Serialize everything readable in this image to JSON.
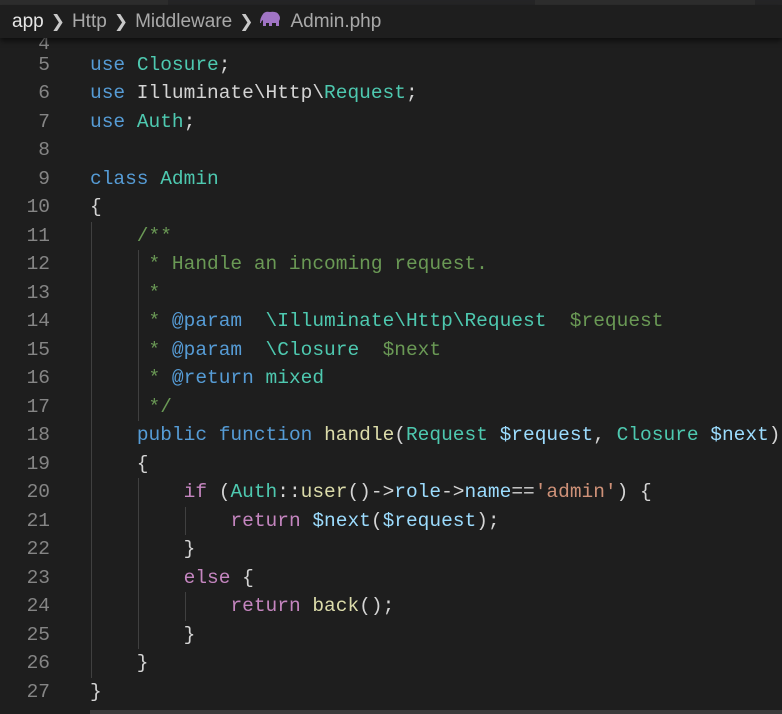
{
  "breadcrumb": {
    "items": [
      "app",
      "Http",
      "Middleware",
      "Admin.php"
    ],
    "file_icon": "php-elephant-icon",
    "separator_icon": "chevron-right-icon"
  },
  "editor": {
    "partial_line_number": "4",
    "lines": [
      {
        "n": "5",
        "tokens": [
          {
            "t": "use",
            "c": "kw"
          },
          {
            "t": " ",
            "c": "pl"
          },
          {
            "t": "Closure",
            "c": "ty"
          },
          {
            "t": ";",
            "c": "pl"
          }
        ]
      },
      {
        "n": "6",
        "tokens": [
          {
            "t": "use",
            "c": "kw"
          },
          {
            "t": " Illuminate\\Http\\",
            "c": "pl"
          },
          {
            "t": "Request",
            "c": "ty"
          },
          {
            "t": ";",
            "c": "pl"
          }
        ]
      },
      {
        "n": "7",
        "tokens": [
          {
            "t": "use",
            "c": "kw"
          },
          {
            "t": " ",
            "c": "pl"
          },
          {
            "t": "Auth",
            "c": "ty"
          },
          {
            "t": ";",
            "c": "pl"
          }
        ]
      },
      {
        "n": "8",
        "tokens": []
      },
      {
        "n": "9",
        "tokens": [
          {
            "t": "class",
            "c": "kw"
          },
          {
            "t": " ",
            "c": "pl"
          },
          {
            "t": "Admin",
            "c": "ty"
          }
        ]
      },
      {
        "n": "10",
        "tokens": [
          {
            "t": "{",
            "c": "pl"
          }
        ]
      },
      {
        "n": "11",
        "tokens": [
          {
            "t": "    /**",
            "c": "cm"
          }
        ]
      },
      {
        "n": "12",
        "tokens": [
          {
            "t": "     * Handle an incoming request.",
            "c": "cm"
          }
        ]
      },
      {
        "n": "13",
        "tokens": [
          {
            "t": "     *",
            "c": "cm"
          }
        ]
      },
      {
        "n": "14",
        "tokens": [
          {
            "t": "     * ",
            "c": "cm"
          },
          {
            "t": "@param",
            "c": "kw"
          },
          {
            "t": "  ",
            "c": "cm"
          },
          {
            "t": "\\Illuminate\\Http\\Request",
            "c": "ty"
          },
          {
            "t": "  $request",
            "c": "cm"
          }
        ]
      },
      {
        "n": "15",
        "tokens": [
          {
            "t": "     * ",
            "c": "cm"
          },
          {
            "t": "@param",
            "c": "kw"
          },
          {
            "t": "  ",
            "c": "cm"
          },
          {
            "t": "\\Closure",
            "c": "ty"
          },
          {
            "t": "  $next",
            "c": "cm"
          }
        ]
      },
      {
        "n": "16",
        "tokens": [
          {
            "t": "     * ",
            "c": "cm"
          },
          {
            "t": "@return",
            "c": "kw"
          },
          {
            "t": " ",
            "c": "cm"
          },
          {
            "t": "mixed",
            "c": "ty"
          }
        ]
      },
      {
        "n": "17",
        "tokens": [
          {
            "t": "     */",
            "c": "cm"
          }
        ]
      },
      {
        "n": "18",
        "tokens": [
          {
            "t": "    ",
            "c": "pl"
          },
          {
            "t": "public",
            "c": "kw"
          },
          {
            "t": " ",
            "c": "pl"
          },
          {
            "t": "function",
            "c": "kw"
          },
          {
            "t": " ",
            "c": "pl"
          },
          {
            "t": "handle",
            "c": "fn"
          },
          {
            "t": "(",
            "c": "pl"
          },
          {
            "t": "Request",
            "c": "ty"
          },
          {
            "t": " ",
            "c": "pl"
          },
          {
            "t": "$request",
            "c": "va"
          },
          {
            "t": ", ",
            "c": "pl"
          },
          {
            "t": "Closure",
            "c": "ty"
          },
          {
            "t": " ",
            "c": "pl"
          },
          {
            "t": "$next",
            "c": "va"
          },
          {
            "t": ")",
            "c": "pl"
          }
        ]
      },
      {
        "n": "19",
        "tokens": [
          {
            "t": "    {",
            "c": "pl"
          }
        ]
      },
      {
        "n": "20",
        "tokens": [
          {
            "t": "        ",
            "c": "pl"
          },
          {
            "t": "if",
            "c": "ct"
          },
          {
            "t": " (",
            "c": "pl"
          },
          {
            "t": "Auth",
            "c": "ty"
          },
          {
            "t": "::",
            "c": "pl"
          },
          {
            "t": "user",
            "c": "fn"
          },
          {
            "t": "()->",
            "c": "pl"
          },
          {
            "t": "role",
            "c": "va"
          },
          {
            "t": "->",
            "c": "pl"
          },
          {
            "t": "name",
            "c": "va"
          },
          {
            "t": "==",
            "c": "pl"
          },
          {
            "t": "'admin'",
            "c": "st"
          },
          {
            "t": ") {",
            "c": "pl"
          }
        ]
      },
      {
        "n": "21",
        "tokens": [
          {
            "t": "            ",
            "c": "pl"
          },
          {
            "t": "return",
            "c": "ct"
          },
          {
            "t": " ",
            "c": "pl"
          },
          {
            "t": "$next",
            "c": "va"
          },
          {
            "t": "(",
            "c": "pl"
          },
          {
            "t": "$request",
            "c": "va"
          },
          {
            "t": ");",
            "c": "pl"
          }
        ]
      },
      {
        "n": "22",
        "tokens": [
          {
            "t": "        }",
            "c": "pl"
          }
        ]
      },
      {
        "n": "23",
        "tokens": [
          {
            "t": "        ",
            "c": "pl"
          },
          {
            "t": "else",
            "c": "ct"
          },
          {
            "t": " {",
            "c": "pl"
          }
        ]
      },
      {
        "n": "24",
        "tokens": [
          {
            "t": "            ",
            "c": "pl"
          },
          {
            "t": "return",
            "c": "ct"
          },
          {
            "t": " ",
            "c": "pl"
          },
          {
            "t": "back",
            "c": "fn"
          },
          {
            "t": "();",
            "c": "pl"
          }
        ]
      },
      {
        "n": "25",
        "tokens": [
          {
            "t": "        }",
            "c": "pl"
          }
        ]
      },
      {
        "n": "26",
        "tokens": [
          {
            "t": "    }",
            "c": "pl"
          }
        ]
      },
      {
        "n": "27",
        "tokens": [
          {
            "t": "}",
            "c": "pl"
          }
        ]
      }
    ]
  },
  "colors": {
    "background": "#1e1e1e",
    "keyword": "#569cd6",
    "type": "#4ec9b0",
    "function": "#dcdcaa",
    "variable": "#9cdcfe",
    "control": "#c586c0",
    "string": "#ce9178",
    "comment": "#6a9955"
  }
}
